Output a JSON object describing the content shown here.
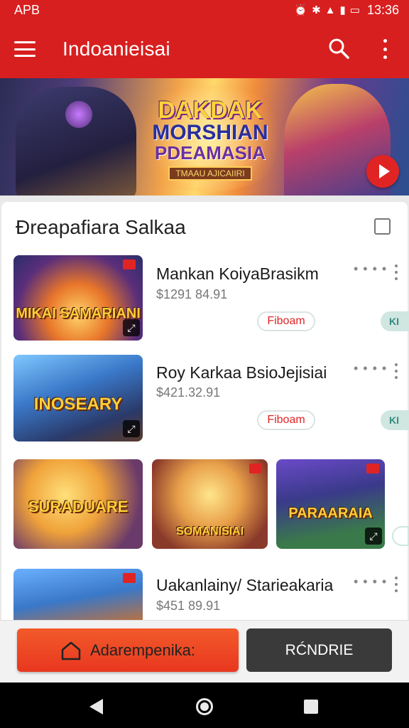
{
  "status_bar": {
    "carrier": "APB",
    "time": "13:36"
  },
  "app_bar": {
    "title": "Indoanieisai"
  },
  "banner": {
    "logo_line1": "DAKDAK",
    "logo_line2": "MORSHIAN",
    "logo_line3": "PDEAMASIA",
    "logo_tag": "TMAAU AJICAIIRI"
  },
  "section": {
    "title": "Đreapafiara Salkaa"
  },
  "items": [
    {
      "title": "Mankan KoiyaBrasikm",
      "price": "$1291 84.91",
      "button": "Fiboam",
      "side_tab": "KI",
      "thumb_label": "MIKAI SAMARIANI",
      "accent": "#3d5fb0"
    },
    {
      "title": "Roy Karkaa BsioJejisiai",
      "price": "$421.32.91",
      "button": "Fiboam",
      "side_tab": "KI",
      "thumb_label": "INOSEARY",
      "accent": "#4a7ac8"
    },
    {
      "title": "Uakanlainy/ Starieakaria",
      "price": "$451 89.91",
      "thumb_label": "",
      "accent": "#2f68b8"
    }
  ],
  "grid": [
    {
      "label": "SURADUARE"
    },
    {
      "label": "SOMANISIAI"
    },
    {
      "label": "PARAARAIA"
    }
  ],
  "bottom_bar": {
    "primary_label": "Adarempenika:",
    "secondary_label": "RĆNDRIE"
  },
  "colors": {
    "brand_red": "#d81f1f",
    "accent_orange": "#e8371f"
  }
}
